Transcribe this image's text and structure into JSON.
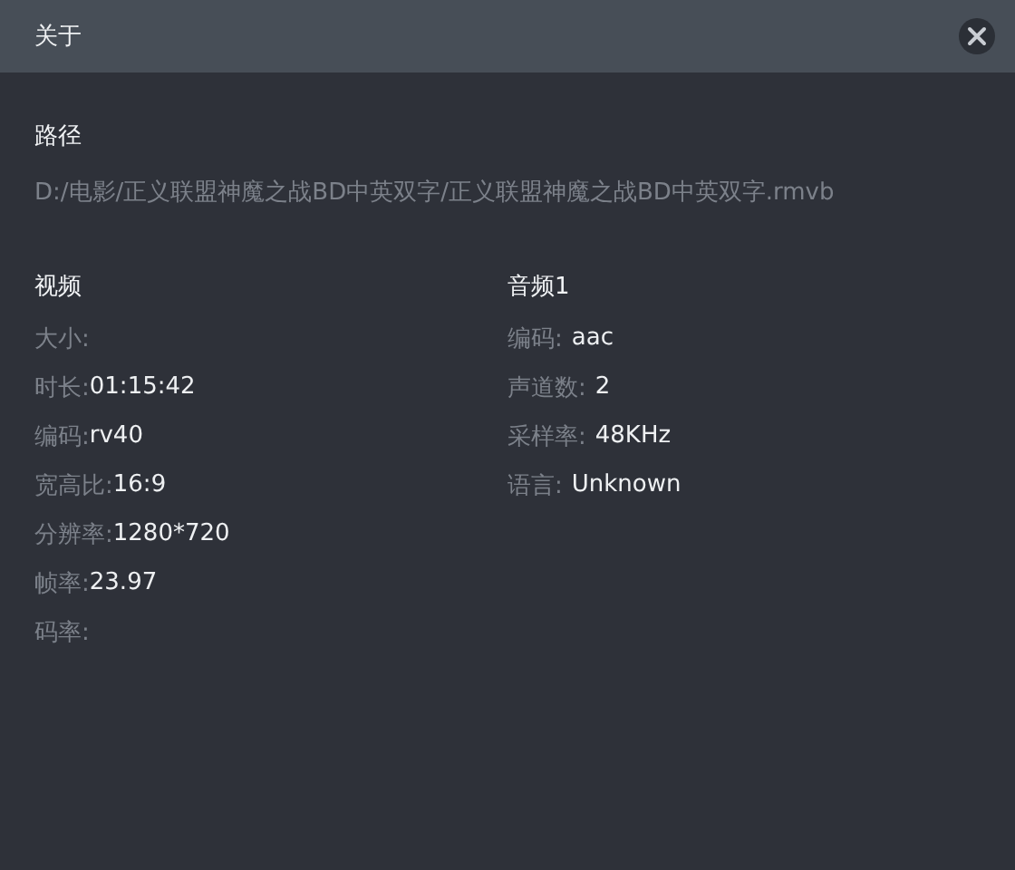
{
  "window": {
    "title": "关于"
  },
  "path": {
    "heading": "路径",
    "value": "D:/电影/正义联盟神魔之战BD中英双字/正义联盟神魔之战BD中英双字.rmvb"
  },
  "sections": [
    {
      "heading": "视频",
      "spaced": false,
      "rows": [
        {
          "label": "大小:"
        },
        {
          "label": "时长:",
          "value": "01:15:42"
        },
        {
          "label": "编码:",
          "value": "rv40"
        },
        {
          "label": "宽高比:",
          "value": "16:9"
        },
        {
          "label": "分辨率:",
          "value": "1280*720"
        },
        {
          "label": "帧率:",
          "value": "23.97"
        },
        {
          "label": "码率:"
        }
      ]
    },
    {
      "heading": "音频1",
      "spaced": true,
      "rows": [
        {
          "label": "编码:",
          "value": "aac"
        },
        {
          "label": "声道数:",
          "value": "2"
        },
        {
          "label": "采样率:",
          "value": "48KHz"
        },
        {
          "label": "语言:",
          "value": "Unknown"
        }
      ]
    }
  ]
}
